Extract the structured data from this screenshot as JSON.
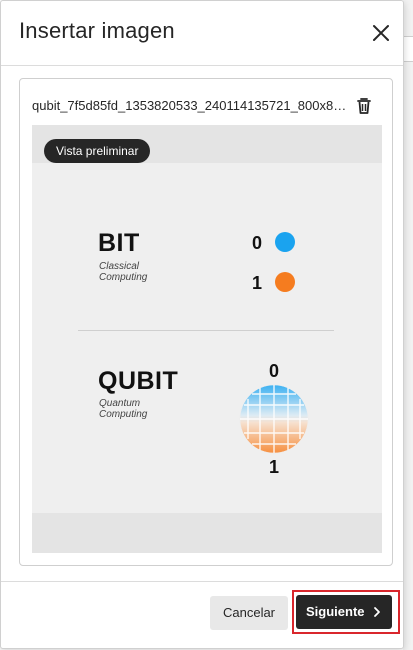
{
  "dialog": {
    "title": "Insertar imagen",
    "close_icon": "close-icon"
  },
  "file": {
    "name": "qubit_7f5d85fd_1353820533_240114135721_800x800.jpg",
    "delete_icon": "trash-icon"
  },
  "preview": {
    "badge": "Vista preliminar",
    "image": {
      "bit_title": "BIT",
      "bit_caption_1": "Classical",
      "bit_caption_2": "Computing",
      "bit_zero": "0",
      "bit_one": "1",
      "qubit_title": "QUBIT",
      "qubit_caption_1": "Quantum",
      "qubit_caption_2": "Computing",
      "qubit_zero": "0",
      "qubit_one": "1",
      "colors": {
        "blue": "#1aa3ef",
        "orange": "#f57c1f"
      }
    }
  },
  "footer": {
    "cancel_label": "Cancelar",
    "next_label": "Siguiente",
    "next_icon": "chevron-right-icon",
    "highlight_color": "#d9262c"
  }
}
